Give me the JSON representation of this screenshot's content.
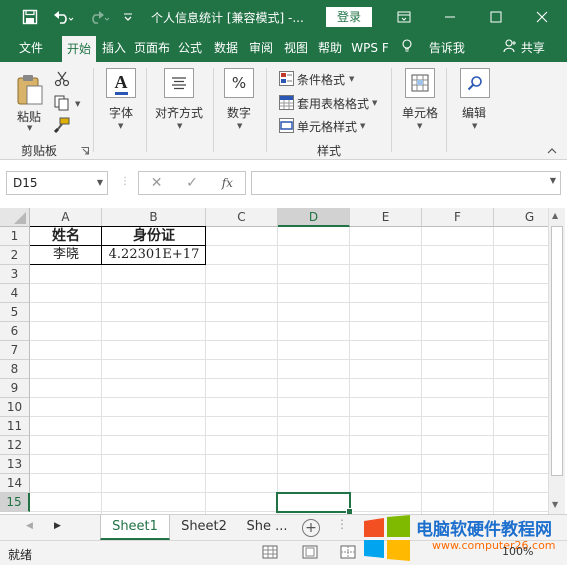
{
  "titlebar": {
    "save_icon": "save-icon",
    "undo_icon": "undo-icon",
    "redo_icon": "redo-icon",
    "customize_icon": "customize-qat-icon",
    "title": "个人信息统计 [兼容模式] -...",
    "login": "登录",
    "colors": {
      "brand": "#217346"
    }
  },
  "tabs": [
    "文件",
    "开始",
    "插入",
    "页面布",
    "公式",
    "数据",
    "审阅",
    "视图",
    "帮助",
    "WPS F"
  ],
  "tell_me": "告诉我",
  "share": "共享",
  "ribbon": {
    "paste": "粘贴",
    "clipboard": "剪贴板",
    "font": "字体",
    "align": "对齐方式",
    "number": "数字",
    "cond_format": "条件格式",
    "table_format": "套用表格格式",
    "cell_style": "单元格样式",
    "styles": "样式",
    "cells": "单元格",
    "edit": "编辑",
    "font_glyph": "A",
    "number_glyph": "%"
  },
  "formula": {
    "namebox": "D15",
    "fx": "fx",
    "value": ""
  },
  "columns": [
    "A",
    "B",
    "C",
    "D",
    "E",
    "F",
    "G"
  ],
  "rows": [
    "1",
    "2",
    "3",
    "4",
    "5",
    "6",
    "7",
    "8",
    "9",
    "10",
    "11",
    "12",
    "13",
    "14",
    "15"
  ],
  "cells": {
    "A1": "姓名",
    "B1": "身份证",
    "A2": "李晓",
    "B2": "4.22301E+17"
  },
  "selected": {
    "col": "D",
    "row": "15"
  },
  "sheets": [
    "Sheet1",
    "Sheet2",
    "She ..."
  ],
  "status": {
    "ready": "就绪",
    "zoom": "100%"
  },
  "watermark": {
    "name": "电脑软硬件教程网",
    "url": "www.computer26.com"
  }
}
